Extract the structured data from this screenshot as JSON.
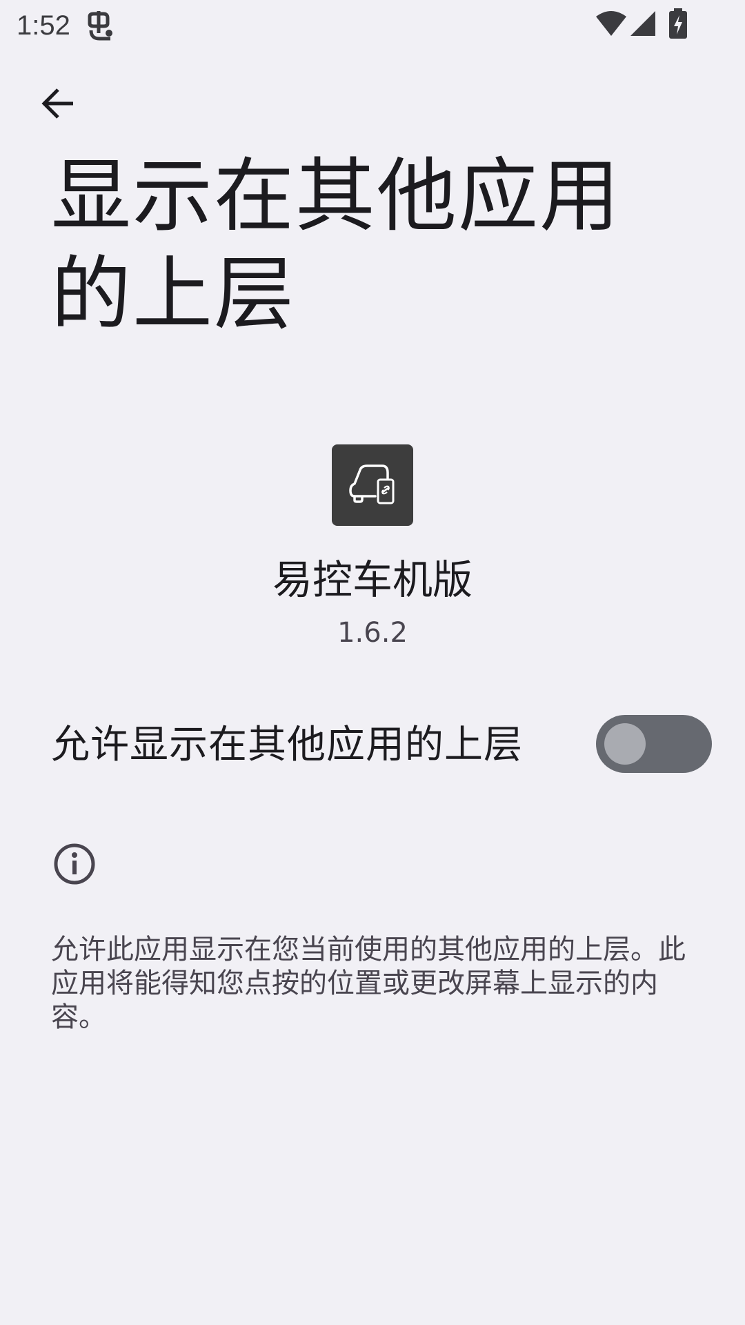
{
  "status_bar": {
    "time": "1:52",
    "notification_icon": "app-notification-icon",
    "wifi_icon": "wifi-icon",
    "signal_icon": "cell-signal-icon",
    "battery_icon": "battery-charging-icon"
  },
  "header": {
    "back_icon": "arrow-back-icon",
    "title": "显示在其他应用的上层"
  },
  "app": {
    "icon": "car-phone-link-icon",
    "name": "易控车机版",
    "version": "1.6.2"
  },
  "setting": {
    "label": "允许显示在其他应用的上层",
    "enabled": false
  },
  "footer": {
    "info_icon": "info-icon",
    "description": "允许此应用显示在您当前使用的其他应用的上层。此应用将能得知您点按的位置或更改屏幕上显示的内容。"
  },
  "colors": {
    "background": "#f1f0f5",
    "text_primary": "#1c1b1f",
    "text_secondary": "#49454f",
    "switch_track_off": "#666970",
    "switch_thumb_off": "#a9abb1",
    "app_icon_bg": "#3d3d3d"
  }
}
